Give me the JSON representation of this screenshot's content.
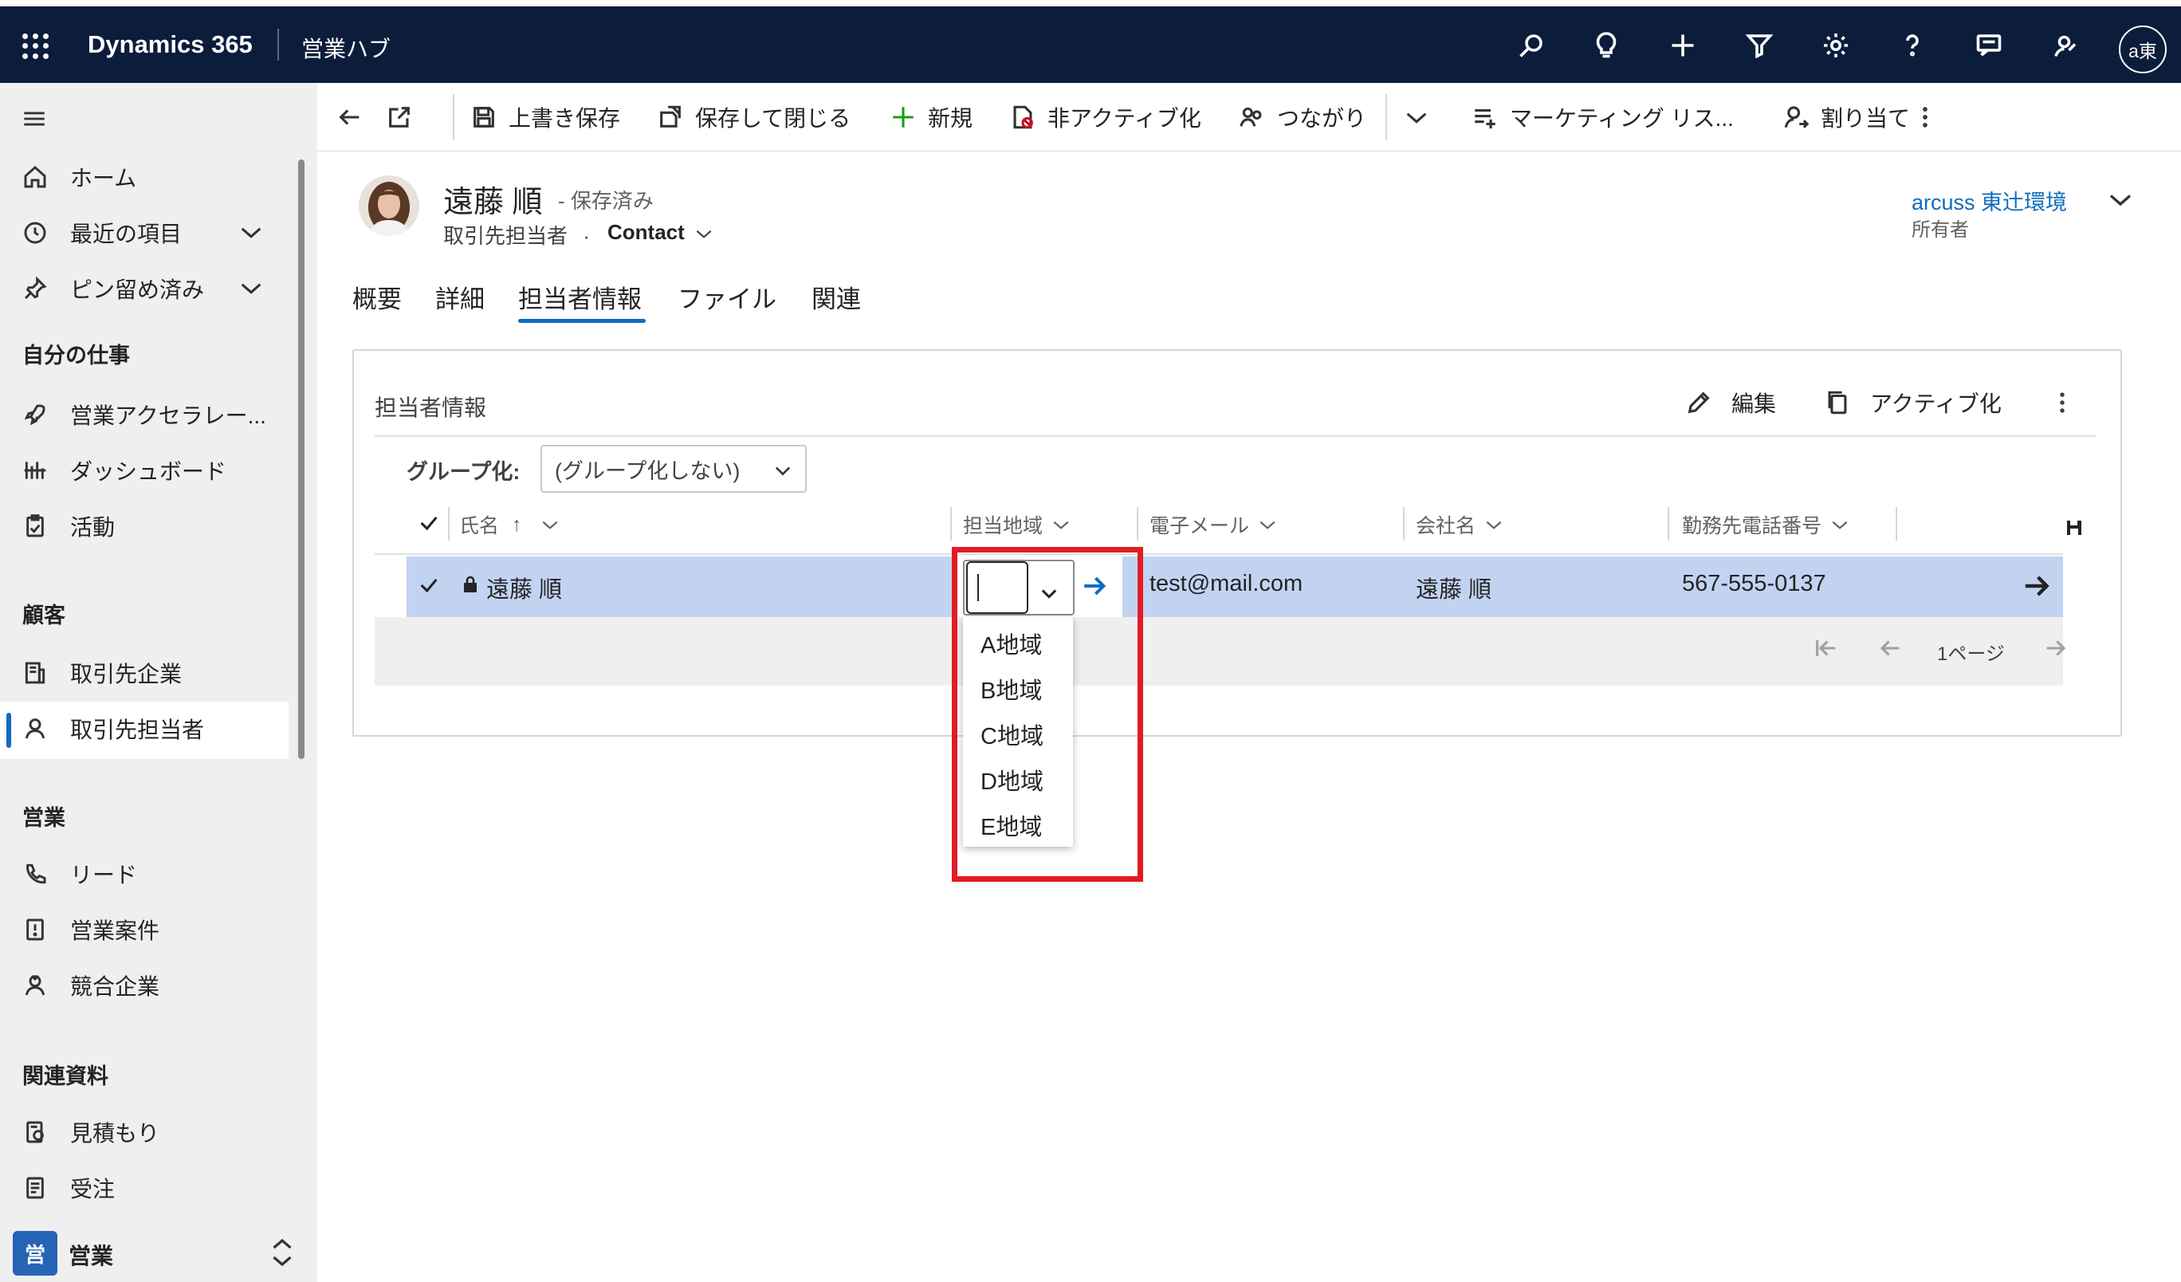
{
  "app": {
    "brand": "Dynamics 365",
    "hub": "営業ハブ",
    "user_initials": "a東"
  },
  "topbar_icons": [
    "search-icon",
    "lightbulb-icon",
    "plus-icon",
    "filter-icon",
    "gear-icon",
    "help-icon",
    "chat-icon",
    "person-feedback-icon"
  ],
  "sidebar": {
    "items_top": [
      {
        "label": "ホーム",
        "icon": "home-icon"
      },
      {
        "label": "最近の項目",
        "icon": "clock-icon"
      },
      {
        "label": "ピン留め済み",
        "icon": "pin-icon"
      }
    ],
    "my_work": {
      "heading": "自分の仕事",
      "items": [
        {
          "label": "営業アクセラレー...",
          "icon": "rocket-icon"
        },
        {
          "label": "ダッシュボード",
          "icon": "dashboard-icon"
        },
        {
          "label": "活動",
          "icon": "clipboard-icon"
        }
      ]
    },
    "customers": {
      "heading": "顧客",
      "items": [
        {
          "label": "取引先企業",
          "icon": "building-icon"
        },
        {
          "label": "取引先担当者",
          "icon": "person-icon"
        }
      ]
    },
    "sales": {
      "heading": "営業",
      "items": [
        {
          "label": "リード",
          "icon": "phone-icon"
        },
        {
          "label": "営業案件",
          "icon": "opportunity-icon"
        },
        {
          "label": "競合企業",
          "icon": "competitor-icon"
        }
      ]
    },
    "collateral": {
      "heading": "関連資料",
      "items": [
        {
          "label": "見積もり",
          "icon": "quote-icon"
        },
        {
          "label": "受注",
          "icon": "order-icon"
        }
      ]
    },
    "area": {
      "badge": "営",
      "label": "営業"
    }
  },
  "commands": {
    "save": "上書き保存",
    "save_close": "保存して閉じる",
    "new": "新規",
    "deactivate": "非アクティブ化",
    "connect": "つながり",
    "marketing_list": "マーケティング リス...",
    "assign": "割り当て"
  },
  "record": {
    "name": "遠藤 順",
    "status": "- 保存済み",
    "type": "取引先担当者",
    "dot": "·",
    "entity": "Contact",
    "owner_name": "arcuss 東辻環境",
    "owner_label": "所有者"
  },
  "tabs": [
    "概要",
    "詳細",
    "担当者情報",
    "ファイル",
    "関連"
  ],
  "active_tab": "担当者情報",
  "section": {
    "title": "担当者情報",
    "edit": "編集",
    "activate": "アクティブ化",
    "group_label": "グループ化:",
    "group_value": "(グループ化しない)"
  },
  "grid": {
    "columns": [
      "氏名",
      "担当地域",
      "電子メール",
      "会社名",
      "勤務先電話番号"
    ],
    "sort_indicator": "↑",
    "rows": [
      {
        "name": "遠藤 順",
        "region": "",
        "email": "test@mail.com",
        "company": "遠藤 順",
        "phone": "567-555-0137"
      }
    ],
    "page_label": "1ページ"
  },
  "region_dropdown": {
    "options": [
      "A地域",
      "B地域",
      "C地域",
      "D地域",
      "E地域"
    ],
    "highlight_color": "#e31b23"
  },
  "colors": {
    "topbar": "#0b1d3b",
    "accent": "#0f6cbd",
    "row_selected": "#c2d3f2"
  }
}
